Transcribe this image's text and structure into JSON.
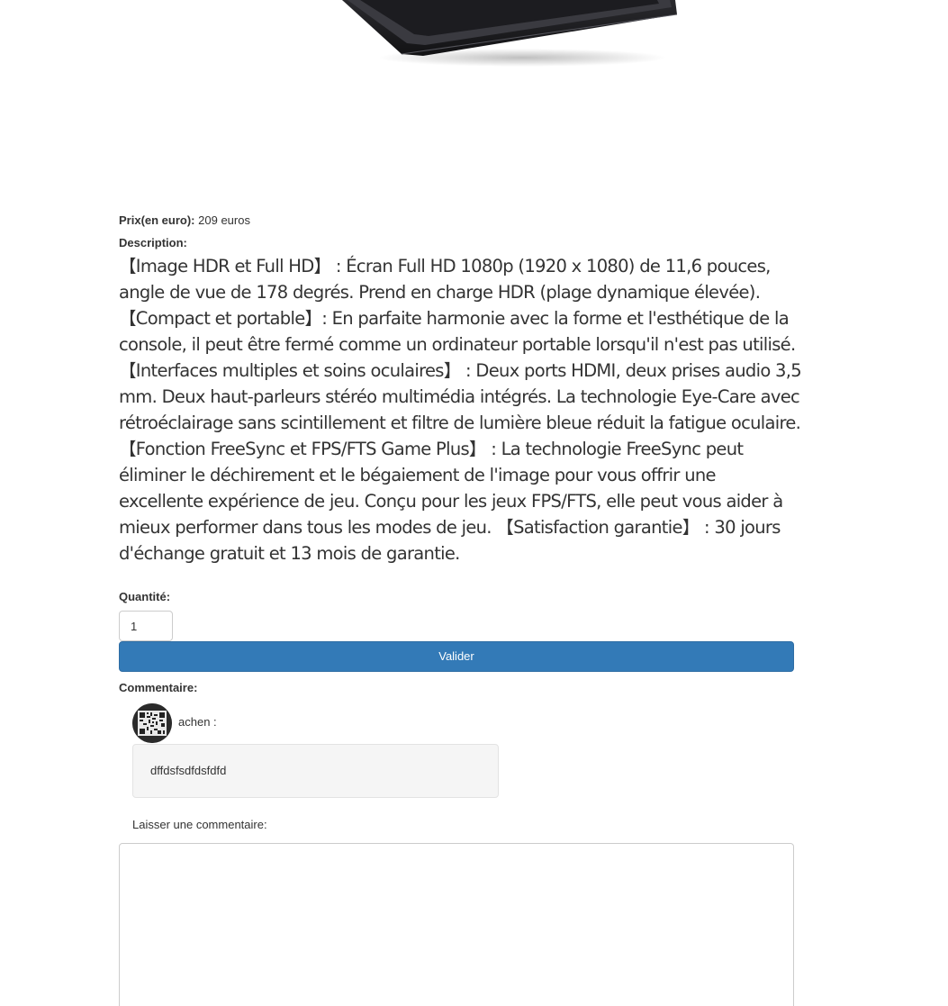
{
  "product": {
    "image_icon": "monitor-product-image",
    "price_label": "Prix(en euro):",
    "price_value": "209 euros",
    "description_label": "Description:",
    "description": "【Image HDR et Full HD】 : Écran Full HD 1080p (1920 x 1080) de 11,6 pouces, angle de vue de 178 degrés. Prend en charge HDR (plage dynamique élevée). 【Compact et portable】: En parfaite harmonie avec la forme et l'esthétique de la console, il peut être fermé comme un ordinateur portable lorsqu'il n'est pas utilisé. 【Interfaces multiples et soins oculaires】 : Deux ports HDMI, deux prises audio 3,5 mm. Deux haut-parleurs stéréo multimédia intégrés. La technologie Eye-Care avec rétroéclairage sans scintillement et filtre de lumière bleue réduit la fatigue oculaire. 【Fonction FreeSync et FPS/FTS Game Plus】 : La technologie FreeSync peut éliminer le déchirement et le bégaiement de l'image pour vous offrir une excellente expérience de jeu. Conçu pour les jeux FPS/FTS, elle peut vous aider à mieux performer dans tous les modes de jeu. 【Satisfaction garantie】 : 30 jours d'échange gratuit et 13 mois de garantie."
  },
  "order": {
    "quantity_label": "Quantité:",
    "quantity_value": "1",
    "validate_label": "Valider",
    "button_color": "#337ab7"
  },
  "comments": {
    "section_label": "Commentaire:",
    "items": [
      {
        "avatar_icon": "qr-code-avatar-icon",
        "author": "achen :",
        "text": "dffdsfsdfdsfdfd"
      }
    ],
    "leave_label": "Laisser une commentaire:",
    "textarea_value": ""
  }
}
